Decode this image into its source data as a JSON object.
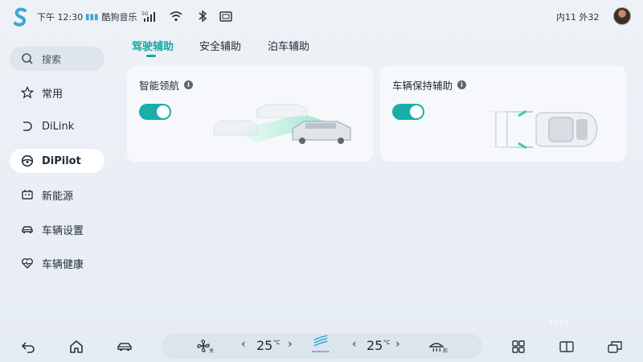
{
  "status_bar": {
    "time": "下午 12:30",
    "music_app": "酷狗音乐",
    "temperature": "内11 外32",
    "icons": [
      "signal-5g-icon",
      "wifi-icon",
      "bluetooth-icon",
      "screen-icon"
    ]
  },
  "sidebar": {
    "search_label": "搜索",
    "items": [
      {
        "label": "常用",
        "icon": "star-icon"
      },
      {
        "label": "DiLink",
        "icon": "dilink-icon"
      },
      {
        "label": "DiPilot",
        "icon": "steering-wheel-icon",
        "active": true
      },
      {
        "label": "新能源",
        "icon": "battery-icon"
      },
      {
        "label": "车辆设置",
        "icon": "car-icon"
      },
      {
        "label": "车辆健康",
        "icon": "heart-pulse-icon"
      }
    ]
  },
  "tabs": [
    {
      "label": "驾驶辅助",
      "active": true
    },
    {
      "label": "安全辅助",
      "active": false
    },
    {
      "label": "泊车辅助",
      "active": false
    }
  ],
  "cards": [
    {
      "title": "智能领航",
      "info": "i",
      "enabled": true
    },
    {
      "title": "车辆保持辅助",
      "info": "i",
      "enabled": true
    }
  ],
  "dock": {
    "left_temp": "25",
    "right_temp": "25",
    "temp_unit": "°C",
    "fan_label": "关",
    "defrost_label": "前",
    "chev_left": "‹",
    "chev_right": "›"
  },
  "watermark": "auto",
  "colors": {
    "accent": "#15a8a4",
    "toggle": "#19aeaa"
  }
}
